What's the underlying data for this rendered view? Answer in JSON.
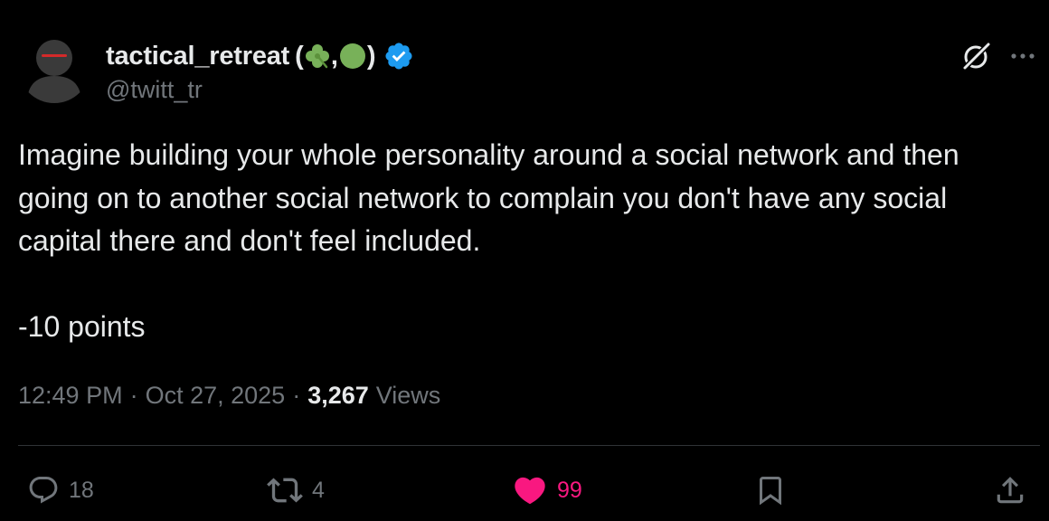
{
  "author": {
    "display_name": "tactical_retreat",
    "name_suffix_open": " (",
    "name_suffix_sep": ",",
    "name_suffix_close": ")",
    "emoji_1": "clover",
    "emoji_2": "green-circle",
    "handle": "@twitt_tr",
    "verified": true,
    "verified_color": "#1d9bf0"
  },
  "tweet": {
    "paragraphs": [
      "Imagine building your whole personality around a social network and then going on to another social network to complain you don't have any social capital there and don't feel included.",
      "-10 points"
    ]
  },
  "meta": {
    "time": "12:49 PM",
    "separator": "·",
    "date": "Oct 27, 2025",
    "views_count": "3,267",
    "views_label": "Views"
  },
  "actions": {
    "replies": "18",
    "reposts": "4",
    "likes": "99",
    "liked": true,
    "like_color": "#f91880"
  },
  "icons": {
    "grok": "grok-icon",
    "more": "more-icon",
    "reply": "reply-icon",
    "repost": "repost-icon",
    "like": "heart-icon",
    "bookmark": "bookmark-icon",
    "share": "share-icon"
  }
}
